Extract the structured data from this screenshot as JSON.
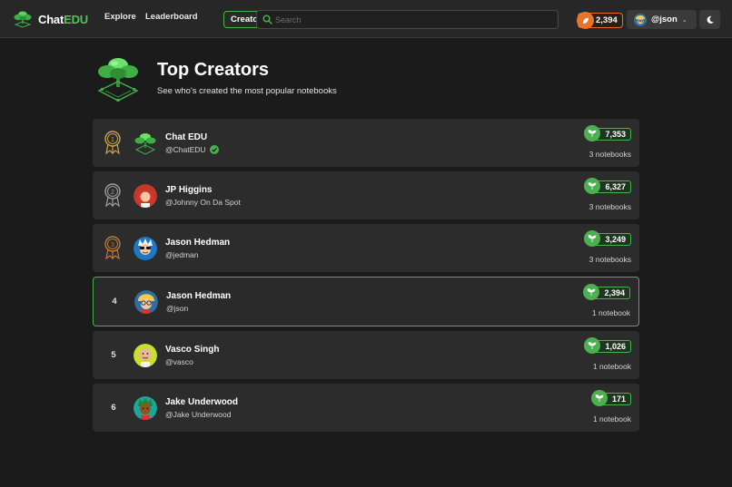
{
  "app": {
    "name_main": "Chat",
    "name_accent": "EDU"
  },
  "nav": {
    "links": [
      "Explore",
      "Leaderboard",
      "Creators"
    ],
    "active": "Creators"
  },
  "search": {
    "placeholder": "Search"
  },
  "user": {
    "coins": "2,394",
    "handle": "@json"
  },
  "page": {
    "title": "Top Creators",
    "subtitle": "See who's created the most popular notebooks"
  },
  "creators": [
    {
      "rank": "1",
      "name": "Chat EDU",
      "handle": "@ChatEDU",
      "verified": true,
      "points": "7,353",
      "notebooks": "3 notebooks",
      "medal_color": "#c9a24a",
      "avatar": "chatedu-logo"
    },
    {
      "rank": "2",
      "name": "JP Higgins",
      "handle": "@Johnny On Da Spot",
      "verified": false,
      "points": "6,327",
      "notebooks": "3 notebooks",
      "medal_color": "#9e9e9e",
      "avatar": "red-hair-avatar"
    },
    {
      "rank": "3",
      "name": "Jason Hedman",
      "handle": "@jedman",
      "verified": false,
      "points": "3,249",
      "notebooks": "3 notebooks",
      "medal_color": "#c0793a",
      "avatar": "sunglasses-avatar"
    },
    {
      "rank": "4",
      "name": "Jason Hedman",
      "handle": "@json",
      "verified": false,
      "points": "2,394",
      "notebooks": "1 notebook",
      "current_user": true,
      "avatar": "blonde-glasses-avatar"
    },
    {
      "rank": "5",
      "name": "Vasco Singh",
      "handle": "@vasco",
      "verified": false,
      "points": "1,026",
      "notebooks": "1 notebook",
      "avatar": "bald-avatar"
    },
    {
      "rank": "6",
      "name": "Jake Underwood",
      "handle": "@Jake Underwood",
      "verified": false,
      "points": "171",
      "notebooks": "1 notebook",
      "avatar": "green-hair-avatar"
    }
  ],
  "colors": {
    "accent": "#4caf50",
    "coin": "#e5762c",
    "background": "#1b1b1b",
    "card": "#2c2c2c"
  }
}
